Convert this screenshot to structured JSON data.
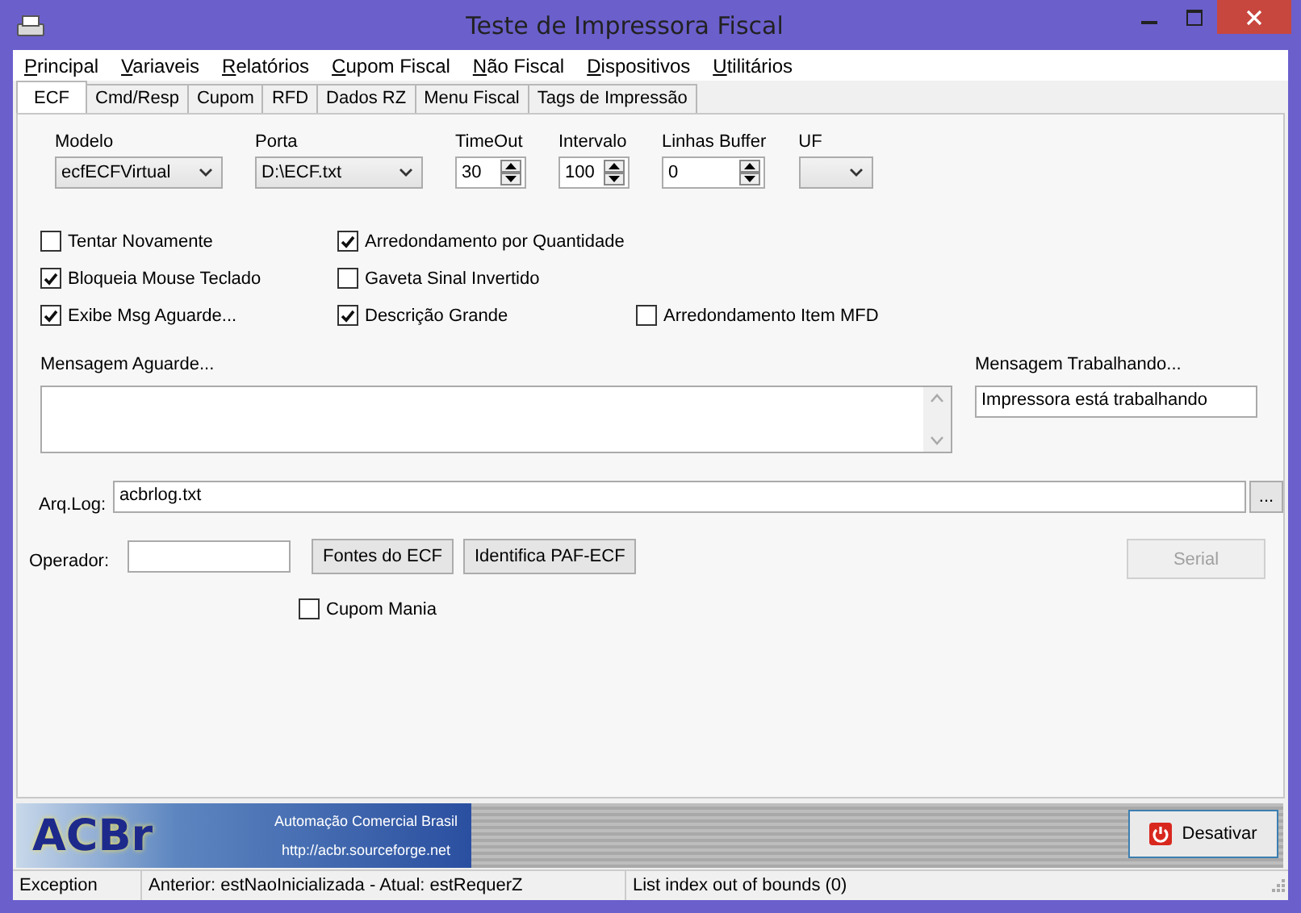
{
  "window": {
    "title": "Teste de Impressora Fiscal"
  },
  "menu": [
    {
      "label": "Principal"
    },
    {
      "label": "Variaveis"
    },
    {
      "label": "Relatórios"
    },
    {
      "label": "Cupom Fiscal"
    },
    {
      "label": "Não Fiscal"
    },
    {
      "label": "Dispositivos"
    },
    {
      "label": "Utilitários"
    }
  ],
  "tabs": [
    {
      "label": "ECF",
      "selected": true
    },
    {
      "label": "Cmd/Resp",
      "selected": false
    },
    {
      "label": "Cupom",
      "selected": false
    },
    {
      "label": "RFD",
      "selected": false
    },
    {
      "label": "Dados RZ",
      "selected": false
    },
    {
      "label": "Menu Fiscal",
      "selected": false
    },
    {
      "label": "Tags de Impressão",
      "selected": false
    }
  ],
  "settings": [
    {
      "label": "Modelo",
      "kind": "combo",
      "value": "ecfECFVirtual"
    },
    {
      "label": "Porta",
      "kind": "combo",
      "value": "D:\\ECF.txt"
    },
    {
      "label": "TimeOut",
      "kind": "spin",
      "value": "30"
    },
    {
      "label": "Intervalo",
      "kind": "spin",
      "value": "100"
    },
    {
      "label": "Linhas Buffer",
      "kind": "spin",
      "value": "0"
    },
    {
      "label": "UF",
      "kind": "combo"
    }
  ],
  "option_rows": [
    [
      {
        "label": "Tentar Novamente",
        "checked": false
      },
      {
        "label": "Arredondamento por Quantidade",
        "checked": true
      }
    ],
    [
      {
        "label": "Bloqueia Mouse Teclado",
        "checked": true
      },
      {
        "label": "Gaveta Sinal Invertido",
        "checked": false
      }
    ],
    [
      {
        "label": "Exibe Msg Aguarde...",
        "checked": true
      },
      {
        "label": "Descrição Grande",
        "checked": true
      },
      {
        "label": "Arredondamento Item MFD",
        "checked": false
      }
    ]
  ],
  "mensagem_aguarde": {
    "label": "Mensagem Aguarde..."
  },
  "mensagem_trabalhando": {
    "label": "Mensagem Trabalhando...",
    "value": "Impressora está trabalhando"
  },
  "arq_log": {
    "label": "Arq.Log:",
    "value": "acbrlog.txt",
    "browse": "..."
  },
  "operador": {
    "label": "Operador:"
  },
  "buttons": [
    {
      "label": "Fontes do ECF",
      "disabled": false
    },
    {
      "label": "Identifica PAF-ECF",
      "disabled": false
    }
  ],
  "serial": {
    "label": "Serial",
    "disabled": true
  },
  "cupom_mania": {
    "label": "Cupom Mania",
    "checked": false
  },
  "logo": {
    "brand": "ACBr",
    "tagline": "Automação Comercial Brasil",
    "url": "http://acbr.sourceforge.net"
  },
  "desativar": {
    "label": "Desativar"
  },
  "status_bar": [
    {
      "text": "Exception"
    },
    {
      "text": "Anterior: estNaoInicializada - Atual: estRequerZ"
    },
    {
      "text": "List index out of bounds (0)"
    }
  ]
}
